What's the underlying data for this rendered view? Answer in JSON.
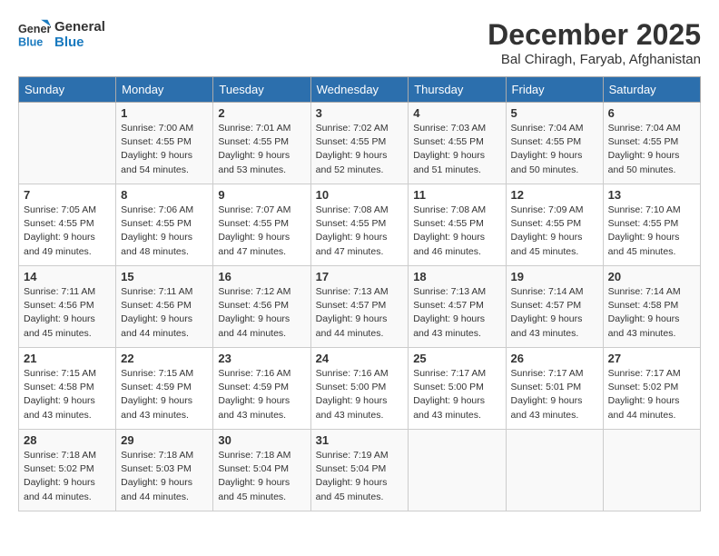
{
  "header": {
    "logo_line1": "General",
    "logo_line2": "Blue",
    "month": "December 2025",
    "location": "Bal Chiragh, Faryab, Afghanistan"
  },
  "weekdays": [
    "Sunday",
    "Monday",
    "Tuesday",
    "Wednesday",
    "Thursday",
    "Friday",
    "Saturday"
  ],
  "weeks": [
    [
      {
        "day": "",
        "info": ""
      },
      {
        "day": "1",
        "info": "Sunrise: 7:00 AM\nSunset: 4:55 PM\nDaylight: 9 hours\nand 54 minutes."
      },
      {
        "day": "2",
        "info": "Sunrise: 7:01 AM\nSunset: 4:55 PM\nDaylight: 9 hours\nand 53 minutes."
      },
      {
        "day": "3",
        "info": "Sunrise: 7:02 AM\nSunset: 4:55 PM\nDaylight: 9 hours\nand 52 minutes."
      },
      {
        "day": "4",
        "info": "Sunrise: 7:03 AM\nSunset: 4:55 PM\nDaylight: 9 hours\nand 51 minutes."
      },
      {
        "day": "5",
        "info": "Sunrise: 7:04 AM\nSunset: 4:55 PM\nDaylight: 9 hours\nand 50 minutes."
      },
      {
        "day": "6",
        "info": "Sunrise: 7:04 AM\nSunset: 4:55 PM\nDaylight: 9 hours\nand 50 minutes."
      }
    ],
    [
      {
        "day": "7",
        "info": "Sunrise: 7:05 AM\nSunset: 4:55 PM\nDaylight: 9 hours\nand 49 minutes."
      },
      {
        "day": "8",
        "info": "Sunrise: 7:06 AM\nSunset: 4:55 PM\nDaylight: 9 hours\nand 48 minutes."
      },
      {
        "day": "9",
        "info": "Sunrise: 7:07 AM\nSunset: 4:55 PM\nDaylight: 9 hours\nand 47 minutes."
      },
      {
        "day": "10",
        "info": "Sunrise: 7:08 AM\nSunset: 4:55 PM\nDaylight: 9 hours\nand 47 minutes."
      },
      {
        "day": "11",
        "info": "Sunrise: 7:08 AM\nSunset: 4:55 PM\nDaylight: 9 hours\nand 46 minutes."
      },
      {
        "day": "12",
        "info": "Sunrise: 7:09 AM\nSunset: 4:55 PM\nDaylight: 9 hours\nand 45 minutes."
      },
      {
        "day": "13",
        "info": "Sunrise: 7:10 AM\nSunset: 4:55 PM\nDaylight: 9 hours\nand 45 minutes."
      }
    ],
    [
      {
        "day": "14",
        "info": "Sunrise: 7:11 AM\nSunset: 4:56 PM\nDaylight: 9 hours\nand 45 minutes."
      },
      {
        "day": "15",
        "info": "Sunrise: 7:11 AM\nSunset: 4:56 PM\nDaylight: 9 hours\nand 44 minutes."
      },
      {
        "day": "16",
        "info": "Sunrise: 7:12 AM\nSunset: 4:56 PM\nDaylight: 9 hours\nand 44 minutes."
      },
      {
        "day": "17",
        "info": "Sunrise: 7:13 AM\nSunset: 4:57 PM\nDaylight: 9 hours\nand 44 minutes."
      },
      {
        "day": "18",
        "info": "Sunrise: 7:13 AM\nSunset: 4:57 PM\nDaylight: 9 hours\nand 43 minutes."
      },
      {
        "day": "19",
        "info": "Sunrise: 7:14 AM\nSunset: 4:57 PM\nDaylight: 9 hours\nand 43 minutes."
      },
      {
        "day": "20",
        "info": "Sunrise: 7:14 AM\nSunset: 4:58 PM\nDaylight: 9 hours\nand 43 minutes."
      }
    ],
    [
      {
        "day": "21",
        "info": "Sunrise: 7:15 AM\nSunset: 4:58 PM\nDaylight: 9 hours\nand 43 minutes."
      },
      {
        "day": "22",
        "info": "Sunrise: 7:15 AM\nSunset: 4:59 PM\nDaylight: 9 hours\nand 43 minutes."
      },
      {
        "day": "23",
        "info": "Sunrise: 7:16 AM\nSunset: 4:59 PM\nDaylight: 9 hours\nand 43 minutes."
      },
      {
        "day": "24",
        "info": "Sunrise: 7:16 AM\nSunset: 5:00 PM\nDaylight: 9 hours\nand 43 minutes."
      },
      {
        "day": "25",
        "info": "Sunrise: 7:17 AM\nSunset: 5:00 PM\nDaylight: 9 hours\nand 43 minutes."
      },
      {
        "day": "26",
        "info": "Sunrise: 7:17 AM\nSunset: 5:01 PM\nDaylight: 9 hours\nand 43 minutes."
      },
      {
        "day": "27",
        "info": "Sunrise: 7:17 AM\nSunset: 5:02 PM\nDaylight: 9 hours\nand 44 minutes."
      }
    ],
    [
      {
        "day": "28",
        "info": "Sunrise: 7:18 AM\nSunset: 5:02 PM\nDaylight: 9 hours\nand 44 minutes."
      },
      {
        "day": "29",
        "info": "Sunrise: 7:18 AM\nSunset: 5:03 PM\nDaylight: 9 hours\nand 44 minutes."
      },
      {
        "day": "30",
        "info": "Sunrise: 7:18 AM\nSunset: 5:04 PM\nDaylight: 9 hours\nand 45 minutes."
      },
      {
        "day": "31",
        "info": "Sunrise: 7:19 AM\nSunset: 5:04 PM\nDaylight: 9 hours\nand 45 minutes."
      },
      {
        "day": "",
        "info": ""
      },
      {
        "day": "",
        "info": ""
      },
      {
        "day": "",
        "info": ""
      }
    ]
  ]
}
